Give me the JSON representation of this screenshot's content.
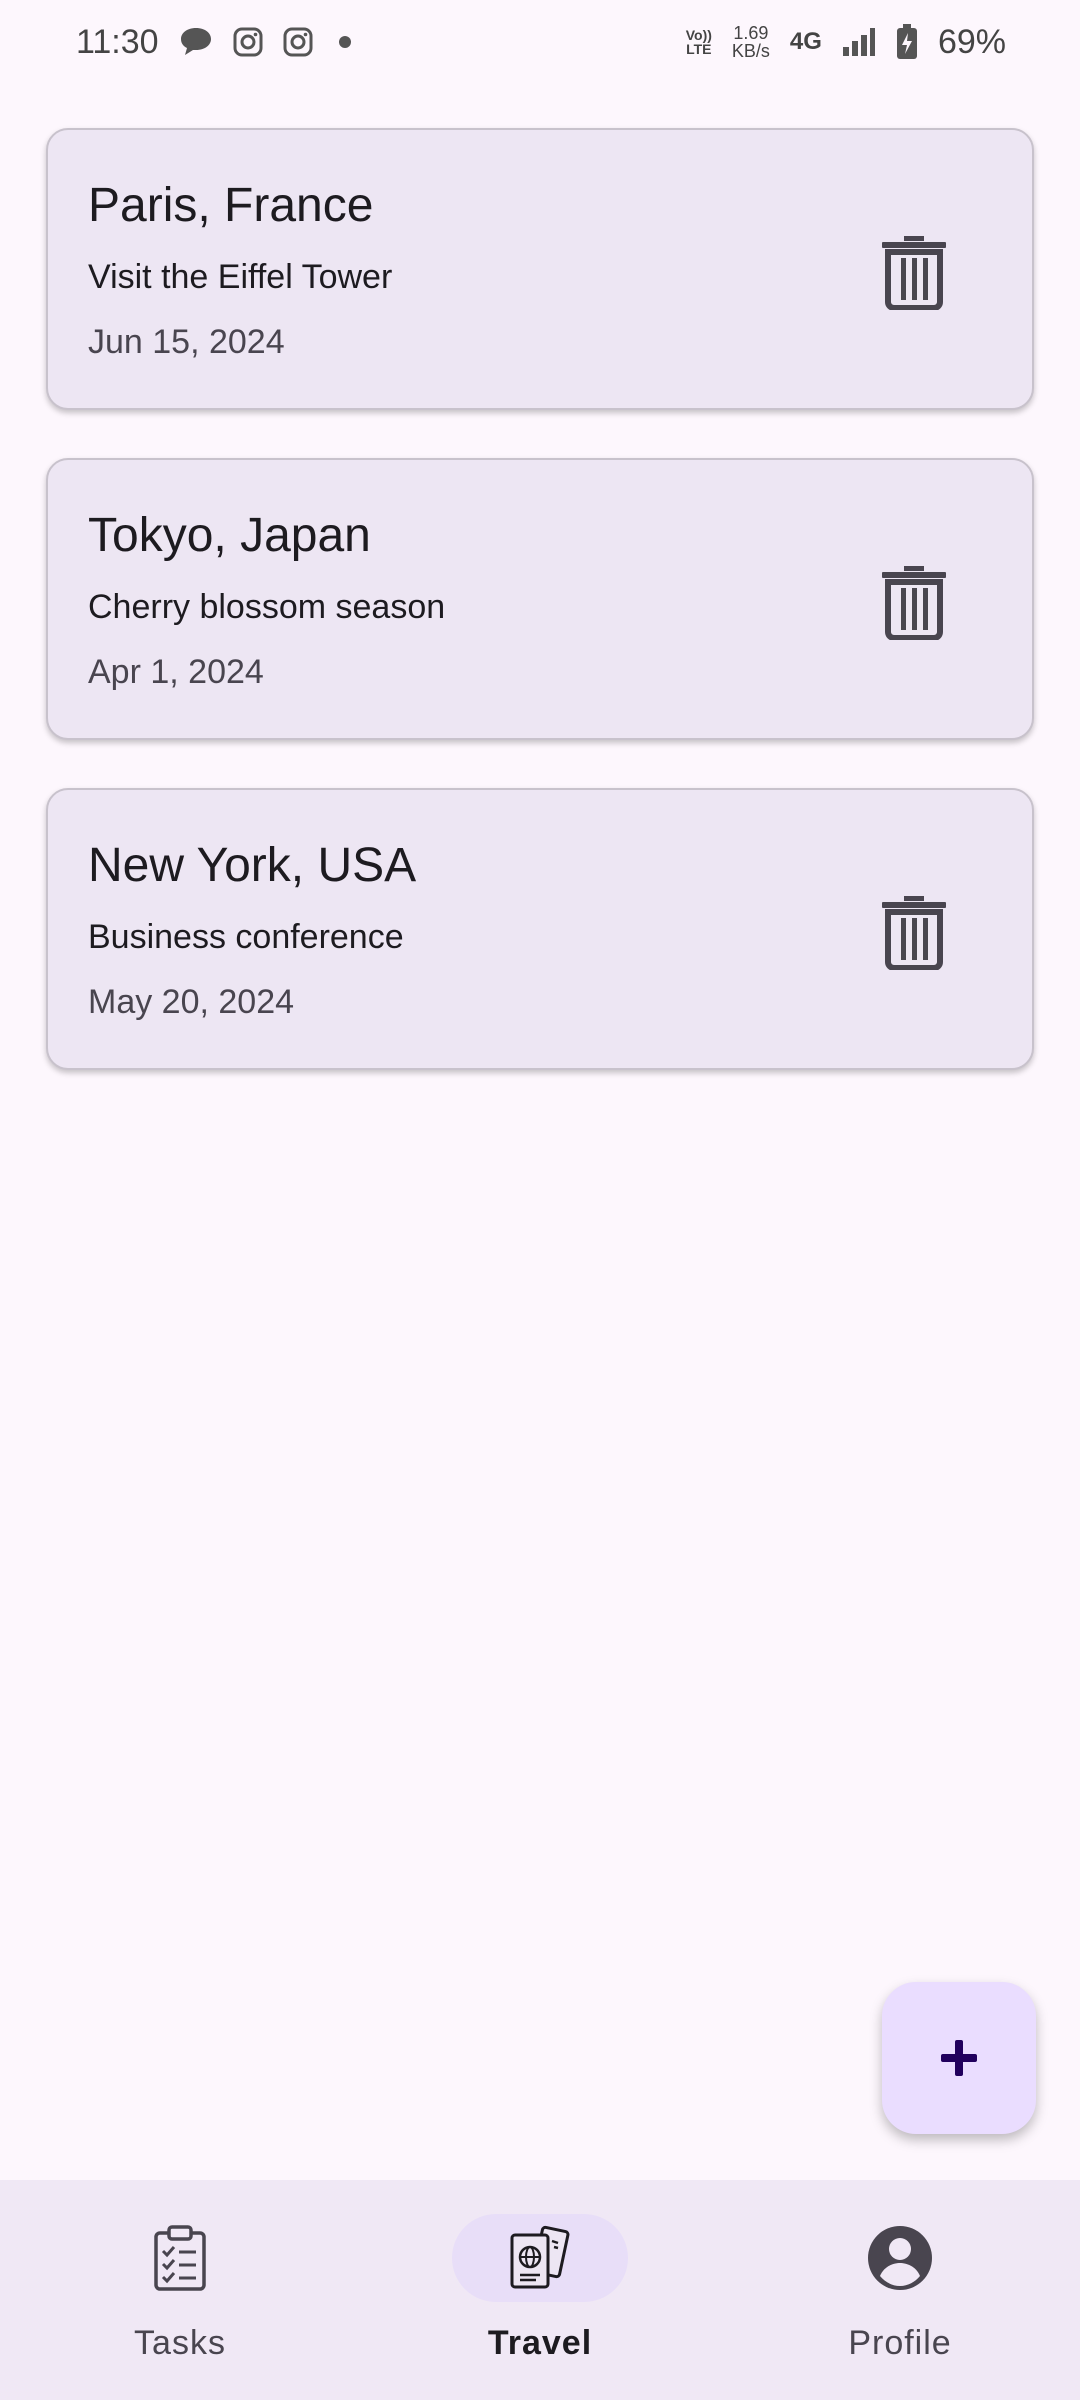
{
  "status_bar": {
    "time": "11:30",
    "notification_icons": [
      "message-icon",
      "instagram-icon",
      "instagram-icon",
      "dot-icon"
    ],
    "volte_line1": "Vo))",
    "volte_line2": "LTE",
    "speed_value": "1.69",
    "speed_unit": "KB/s",
    "network_type": "4G",
    "battery_percent": "69%"
  },
  "trips": [
    {
      "destination": "Paris, France",
      "description": "Visit the Eiffel Tower",
      "date": "Jun 15, 2024"
    },
    {
      "destination": "Tokyo, Japan",
      "description": "Cherry blossom season",
      "date": "Apr 1, 2024"
    },
    {
      "destination": "New York, USA",
      "description": "Business conference",
      "date": "May 20, 2024"
    }
  ],
  "fab": {
    "icon": "plus-icon"
  },
  "bottom_nav": {
    "items": [
      {
        "label": "Tasks",
        "icon": "clipboard-checklist-icon",
        "active": false
      },
      {
        "label": "Travel",
        "icon": "passport-ticket-icon",
        "active": true
      },
      {
        "label": "Profile",
        "icon": "account-circle-icon",
        "active": false
      }
    ]
  },
  "colors": {
    "background": "#fdf7fd",
    "card": "#ede6f3",
    "fab": "#eaddff",
    "nav_bar": "#f0e8f5",
    "active_indicator": "#e8def8"
  }
}
